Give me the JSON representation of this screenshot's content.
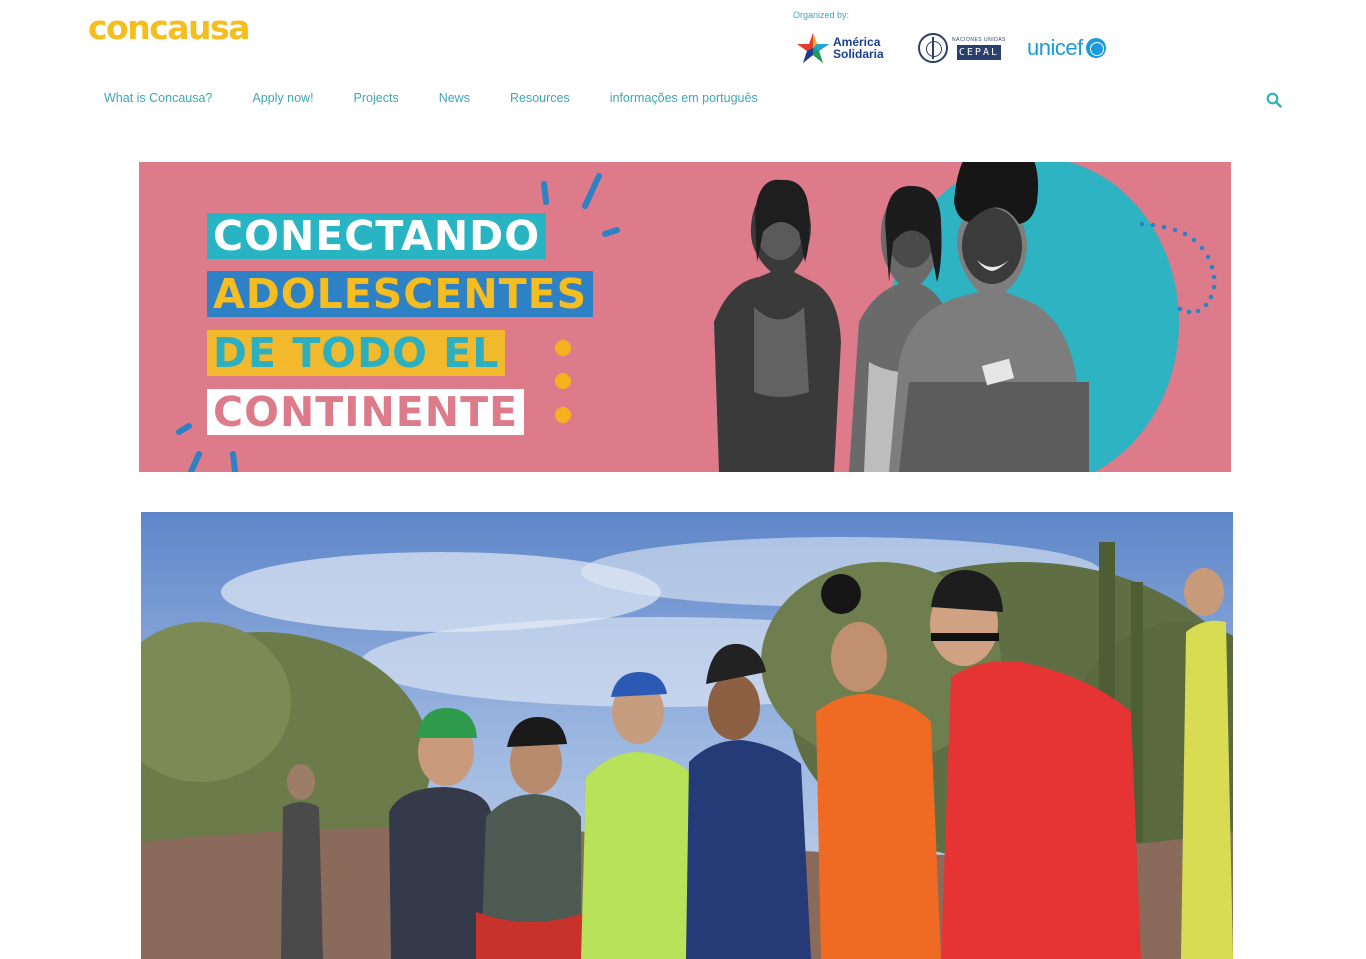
{
  "header": {
    "logo_text": "concausa",
    "organized_label": "Organized by:",
    "partners": {
      "america_solidaria": [
        "América",
        "Solidaria"
      ],
      "cepal": {
        "small": "NACIONES UNIDAS",
        "box": "CEPAL"
      },
      "unicef": "unicef"
    }
  },
  "nav": {
    "items": [
      "What is Concausa?",
      "Apply now!",
      "Projects",
      "News",
      "Resources",
      "informações em português"
    ]
  },
  "banner": {
    "lines": [
      "CONECTANDO",
      "ADOLESCENTES",
      "DE TODO EL",
      "CONTINENTE"
    ]
  },
  "colors": {
    "accent_teal": "#3fa7b5",
    "logo_yellow": "#f5bd1f",
    "banner_pink": "#de7b8a",
    "banner_teal": "#28b4c2",
    "banner_blue": "#2e81c5",
    "banner_yellow": "#f1b92b"
  },
  "icons": {
    "search": "search-icon",
    "america_solidaria": "star-logo-icon",
    "un": "un-emblem-icon"
  }
}
